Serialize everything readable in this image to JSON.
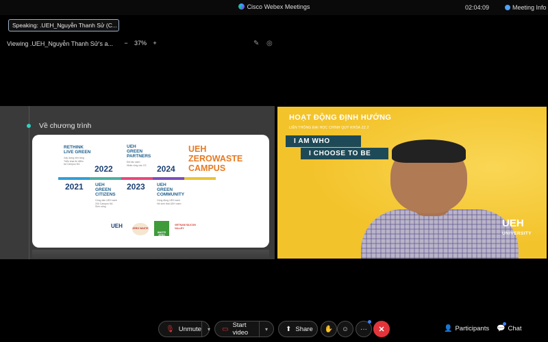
{
  "titlebar": {
    "app_title": "Cisco Webex Meetings",
    "clock": "02:04:09",
    "meeting_info": "Meeting Info"
  },
  "speaking": {
    "label": "Speaking:",
    "name": ".UEH_Nguyễn Thanh Sử (C..."
  },
  "viewing": {
    "text": "Viewing .UEH_Nguyễn Thanh Sử's a...",
    "zoom_minus": "−",
    "zoom_value": "37%",
    "zoom_plus": "+"
  },
  "slide": {
    "heading": "Về chương trình",
    "milestones": [
      {
        "head": "RETHINK\nLIVE GREEN",
        "desc": "Xây dựng nền tảng\nTriển khai thí điểm\ntại Campus N/L"
      },
      {
        "head": "UEH\nGREEN\nCITIZENS",
        "desc": "Công dân UEH xanh\n200 Campus N/L\nSinh sống"
      },
      {
        "head": "UEH\nGREEN\nPARTNERS",
        "desc": "Đối tác xanh\nNhân rộng các CS"
      },
      {
        "head": "UEH\nGREEN\nCOMMUNITY",
        "desc": "Cộng đồng UEH xanh\nHệ sinh thái UEH xanh"
      }
    ],
    "years": [
      "2021",
      "2022",
      "2023",
      "2024"
    ],
    "zerowaste": "UEH\nZEROWASTE\nCAMPUS",
    "logos": [
      "UEH",
      "ZERO WASTE",
      "WASTE ZERO",
      "VIETNAM SILICON VALLEY"
    ]
  },
  "video": {
    "title": "HOẠT ĐỘNG ĐỊNH HƯỚNG",
    "subtitle": "LIÊN THÔNG ĐẠI HỌC CHÍNH QUY KHÓA ZZ.2",
    "line1": "I AM WHO",
    "line2": "I CHOOSE TO BE",
    "brand": "UEH",
    "brand_sub": "UNIVERSITY"
  },
  "controls": {
    "unmute": "Unmute",
    "start_video": "Start video",
    "share": "Share",
    "more": "···",
    "participants": "Participants",
    "chat": "Chat"
  },
  "colors": {
    "leave": "#e2353b",
    "accent": "#3b82f6",
    "slide_year": "#1b3f73",
    "zerowaste": "#e67a21",
    "video_bg": "#f3c32b"
  }
}
